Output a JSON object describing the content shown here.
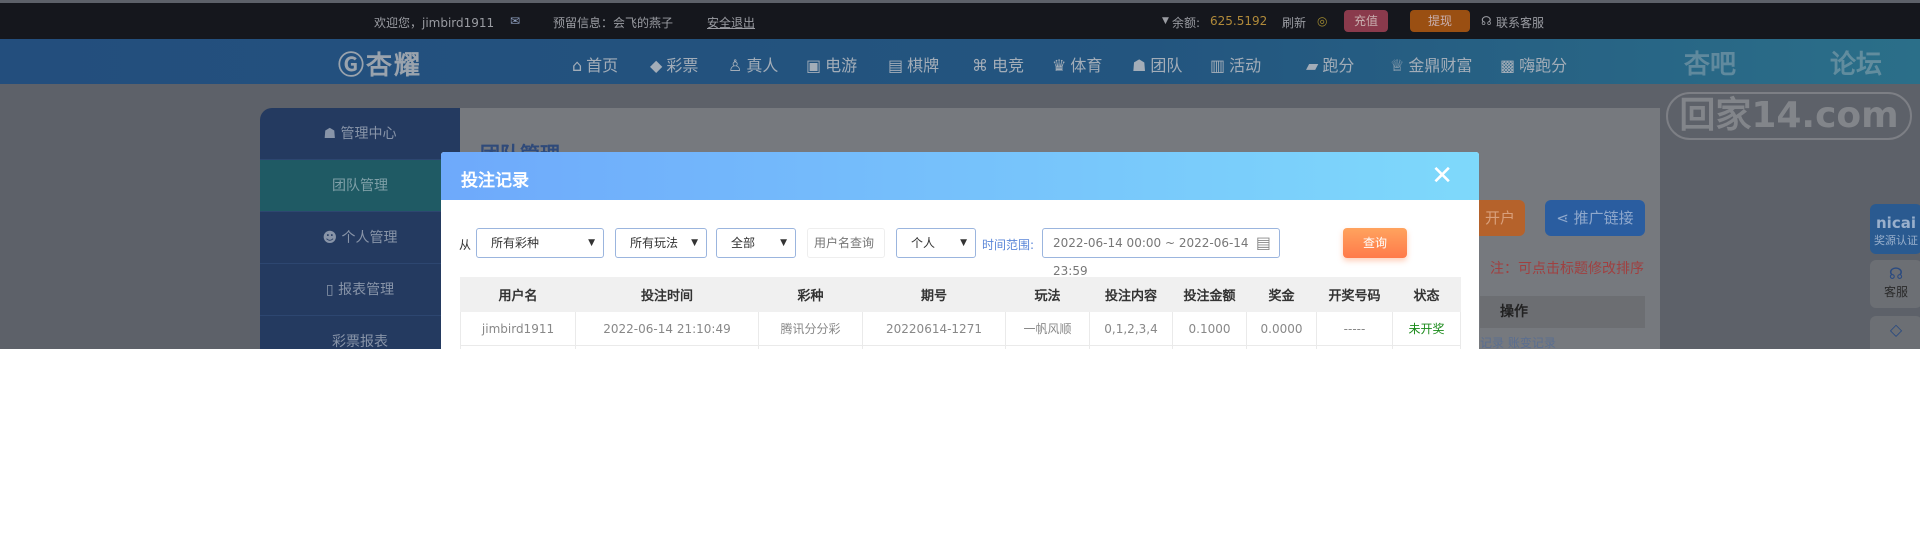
{
  "topbar": {
    "welcome": "欢迎您，jimbird1911",
    "reserved_info": "预留信息：会飞的燕子",
    "logout": "安全退出",
    "balance_label": "余额:",
    "balance": "625.5192",
    "refresh": "刷新",
    "deposit": "充值",
    "withdraw": "提现",
    "support": "联系客服"
  },
  "nav": {
    "logo": "杏耀",
    "items": [
      {
        "label": "首页",
        "icon": "home-icon"
      },
      {
        "label": "彩票",
        "icon": "lottery-icon"
      },
      {
        "label": "真人",
        "icon": "live-icon"
      },
      {
        "label": "电游",
        "icon": "slot-icon"
      },
      {
        "label": "棋牌",
        "icon": "cards-icon"
      },
      {
        "label": "电竞",
        "icon": "gamepad-icon"
      },
      {
        "label": "体育",
        "icon": "trophy-icon"
      },
      {
        "label": "团队",
        "icon": "team-icon"
      },
      {
        "label": "活动",
        "icon": "gift-icon"
      },
      {
        "label": "跑分",
        "icon": "car-icon"
      },
      {
        "label": "金鼎财富",
        "icon": "wealth-icon"
      },
      {
        "label": "嗨跑分",
        "icon": "hi-icon"
      }
    ]
  },
  "watermark": {
    "line1a": "杏吧",
    "line1b": "论坛",
    "line2": "回家14.com"
  },
  "sidebar": {
    "items": [
      {
        "label": "管理中心"
      },
      {
        "label": "团队管理"
      },
      {
        "label": "个人管理"
      },
      {
        "label": "报表管理"
      },
      {
        "label": "彩票报表"
      }
    ]
  },
  "content": {
    "title": "团队管理",
    "open_account": "开户",
    "promo_link": "推广链接",
    "note": "注：可点击标题修改排序",
    "op_header": "操作",
    "op_links": "记录  账变记录"
  },
  "widgets": {
    "nicai": "nicai",
    "nicai_label": "奖源认证",
    "support": "客服"
  },
  "modal": {
    "title": "投注记录",
    "filters": {
      "from": "从",
      "lottery": "所有彩种",
      "play": "所有玩法",
      "status": "全部",
      "username_placeholder": "用户名查询",
      "scope": "个人",
      "time_label": "时间范围:",
      "time_range": "2022-06-14 00:00 ~ 2022-06-14 23:59",
      "query": "查询"
    },
    "columns": [
      "用户名",
      "投注时间",
      "彩种",
      "期号",
      "玩法",
      "投注内容",
      "投注金额",
      "奖金",
      "开奖号码",
      "状态"
    ],
    "rows": [
      [
        "jimbird1911",
        "2022-06-14 21:10:49",
        "腾讯分分彩",
        "20220614-1271",
        "一帆风顺",
        "0,1,2,3,4",
        "0.1000",
        "0.0000",
        "-----",
        "未开奖"
      ]
    ]
  },
  "colors": {
    "header_gradient_start": "#6ea9fb",
    "header_gradient_end": "#7ed9fb",
    "query_button": "#ff8a50",
    "status_pending": "#1a8a1a"
  }
}
